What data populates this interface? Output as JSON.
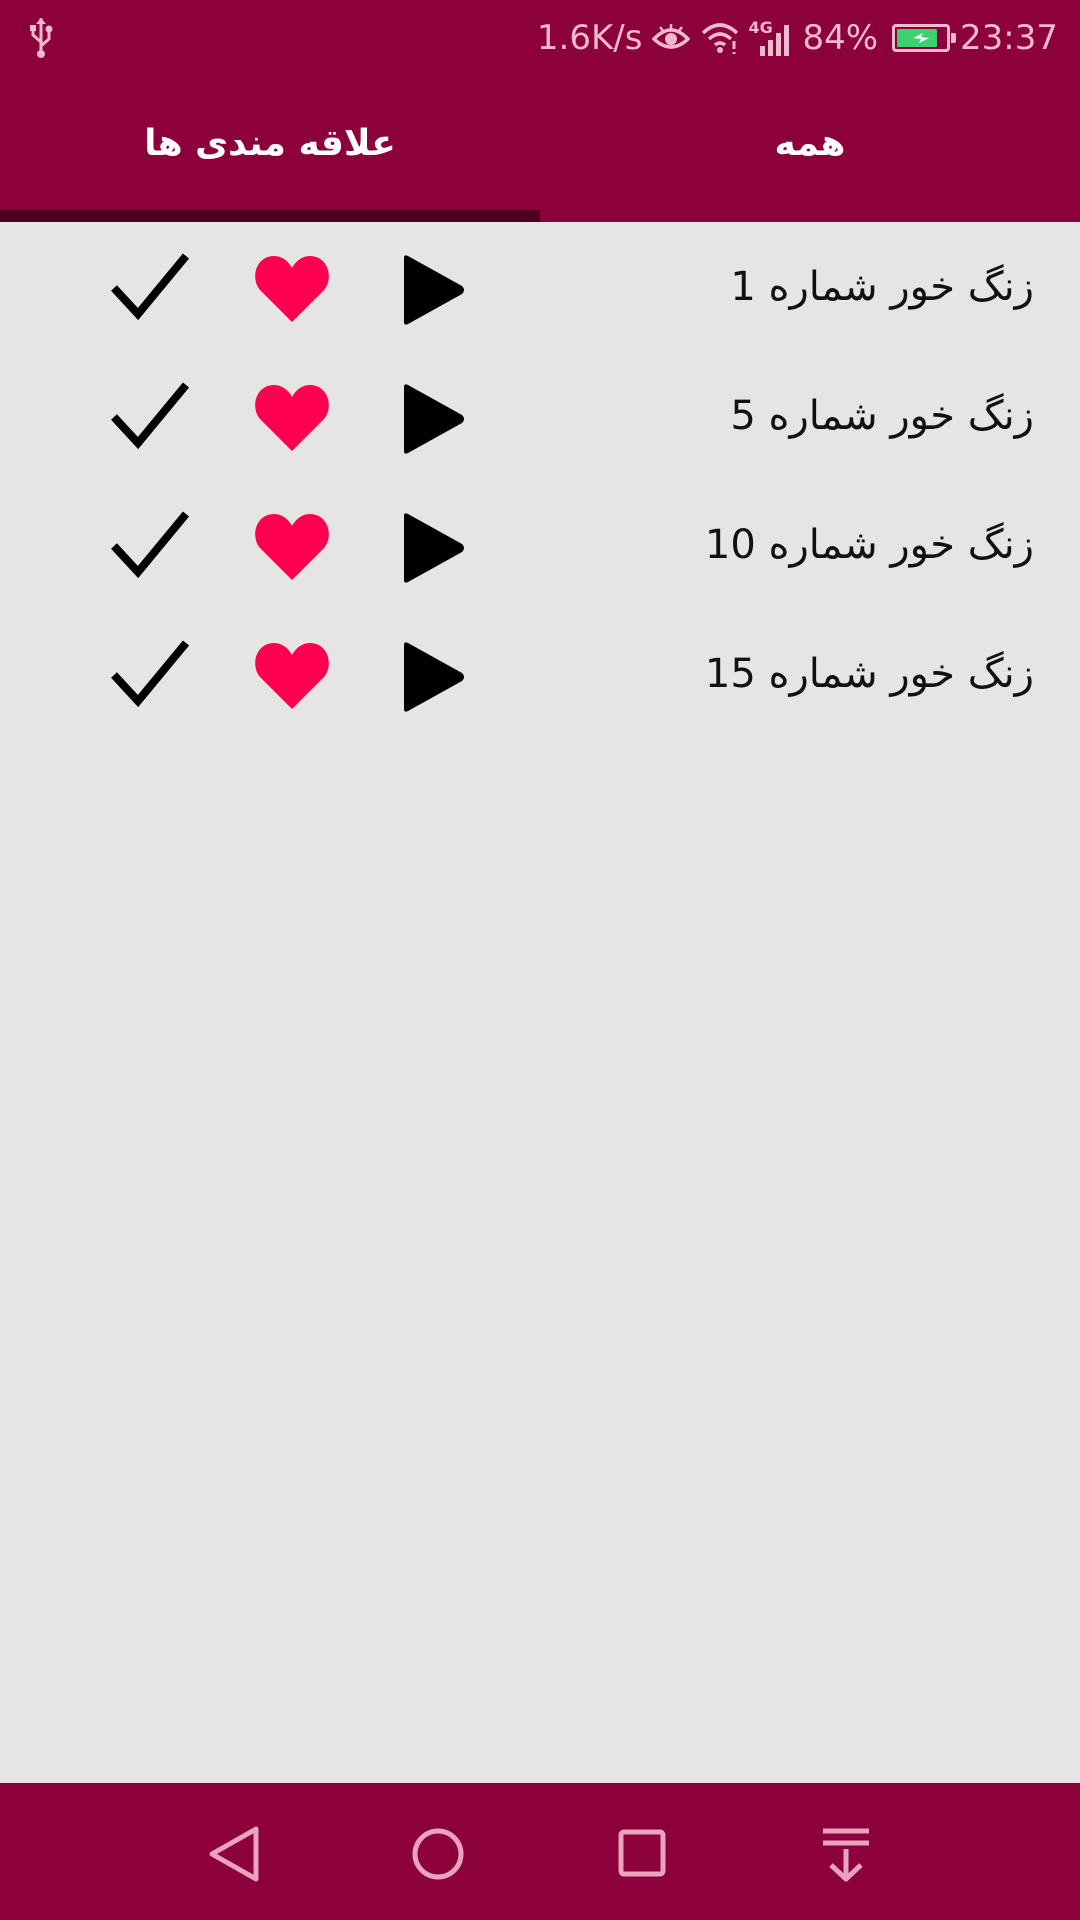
{
  "status_bar": {
    "network_speed": "1.6K/s",
    "network_type": "4G",
    "battery_percent": "84%",
    "battery_level": 0.84,
    "time": "23:37"
  },
  "tabs": [
    {
      "label": "همه",
      "active": false
    },
    {
      "label": "علاقه مندی ها",
      "active": true
    }
  ],
  "ringtones": [
    {
      "title": "زنگ خور شماره 1"
    },
    {
      "title": "زنگ خور شماره 5"
    },
    {
      "title": "زنگ خور شماره 10"
    },
    {
      "title": "زنگ خور شماره 15"
    }
  ],
  "colors": {
    "primary": "#8c003c",
    "tab_indicator": "#4a0020",
    "background": "#e6e5e6",
    "heart": "#ff0051",
    "icon": "#000000",
    "status_text": "#f0b9cc",
    "battery_fill": "#3bd16f"
  },
  "icons": {
    "row_actions": [
      "play-icon",
      "heart-icon",
      "check-icon"
    ],
    "nav": [
      "back-icon",
      "home-icon",
      "recents-icon",
      "notification-pull-icon"
    ]
  }
}
